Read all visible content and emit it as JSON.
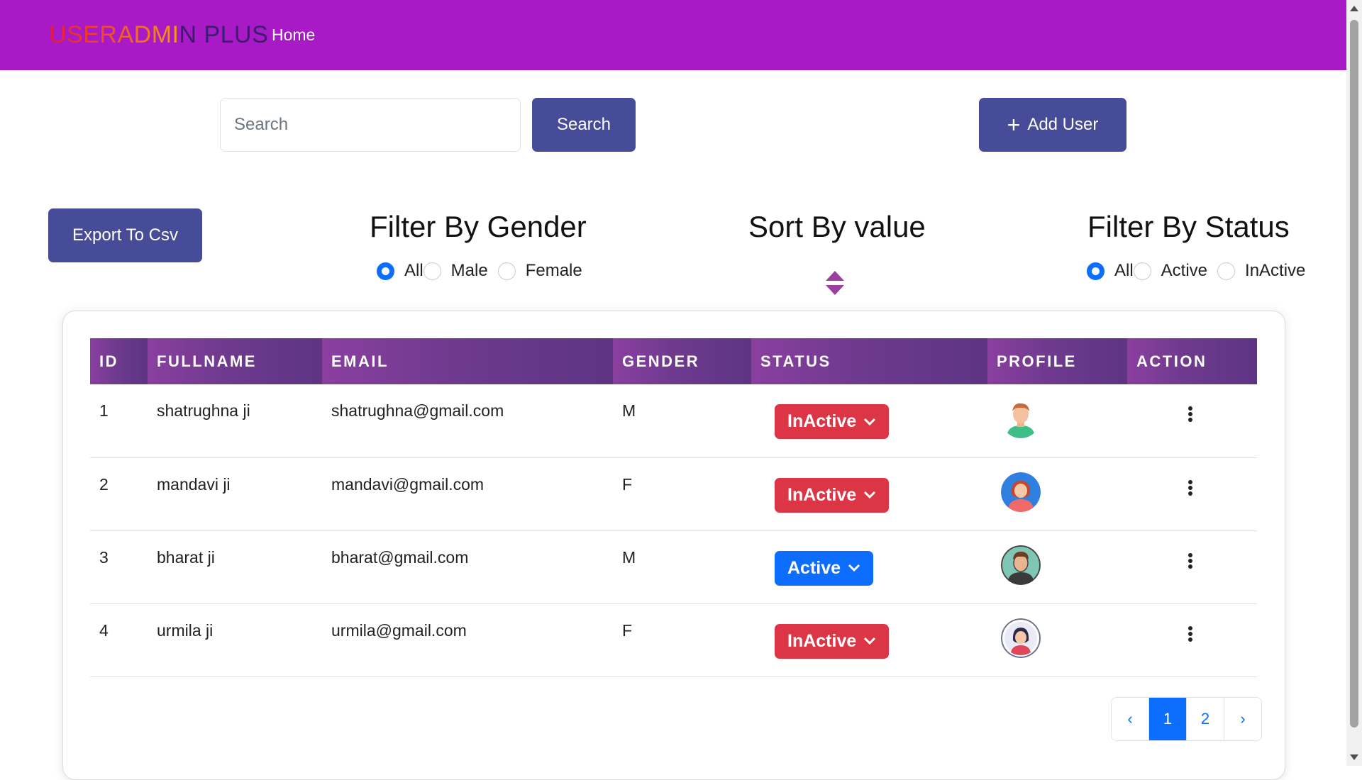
{
  "navbar": {
    "brand_gradient": "USERADMI",
    "brand_rest": "N PLUS",
    "home": "Home",
    "bg_color": "#a81ac6"
  },
  "search": {
    "placeholder": "Search",
    "value": "",
    "button": "Search"
  },
  "add_user": {
    "label": "Add User",
    "icon": "plus-icon"
  },
  "export": {
    "label": "Export To Csv"
  },
  "filter_gender": {
    "title": "Filter By Gender",
    "options": [
      "All",
      "Male",
      "Female"
    ],
    "selected": "All"
  },
  "sort": {
    "title": "Sort By value",
    "icon": "sort-icon"
  },
  "filter_status": {
    "title": "Filter By Status",
    "options": [
      "All",
      "Active",
      "InActive"
    ],
    "selected": "All"
  },
  "table": {
    "headers": [
      "ID",
      "FULLNAME",
      "EMAIL",
      "GENDER",
      "STATUS",
      "PROFILE",
      "ACTION"
    ],
    "rows": [
      {
        "id": "1",
        "fullname": "shatrughna ji",
        "email": "shatrughna@gmail.com",
        "gender": "M",
        "status": "InActive",
        "profile_icon": "avatar-man-icon"
      },
      {
        "id": "2",
        "fullname": "mandavi ji",
        "email": "mandavi@gmail.com",
        "gender": "F",
        "status": "InActive",
        "profile_icon": "avatar-woman-icon"
      },
      {
        "id": "3",
        "fullname": "bharat ji",
        "email": "bharat@gmail.com",
        "gender": "M",
        "status": "Active",
        "profile_icon": "avatar-man-icon"
      },
      {
        "id": "4",
        "fullname": "urmila ji",
        "email": "urmila@gmail.com",
        "gender": "F",
        "status": "InActive",
        "profile_icon": "avatar-woman-icon"
      }
    ]
  },
  "pagination": {
    "prev": "‹",
    "pages": [
      "1",
      "2"
    ],
    "current": "1",
    "next": "›"
  },
  "colors": {
    "primary_button": "#474c98",
    "status_inactive": "#dc3545",
    "status_active": "#0d6efd",
    "header_purple": "#7a3c95"
  }
}
